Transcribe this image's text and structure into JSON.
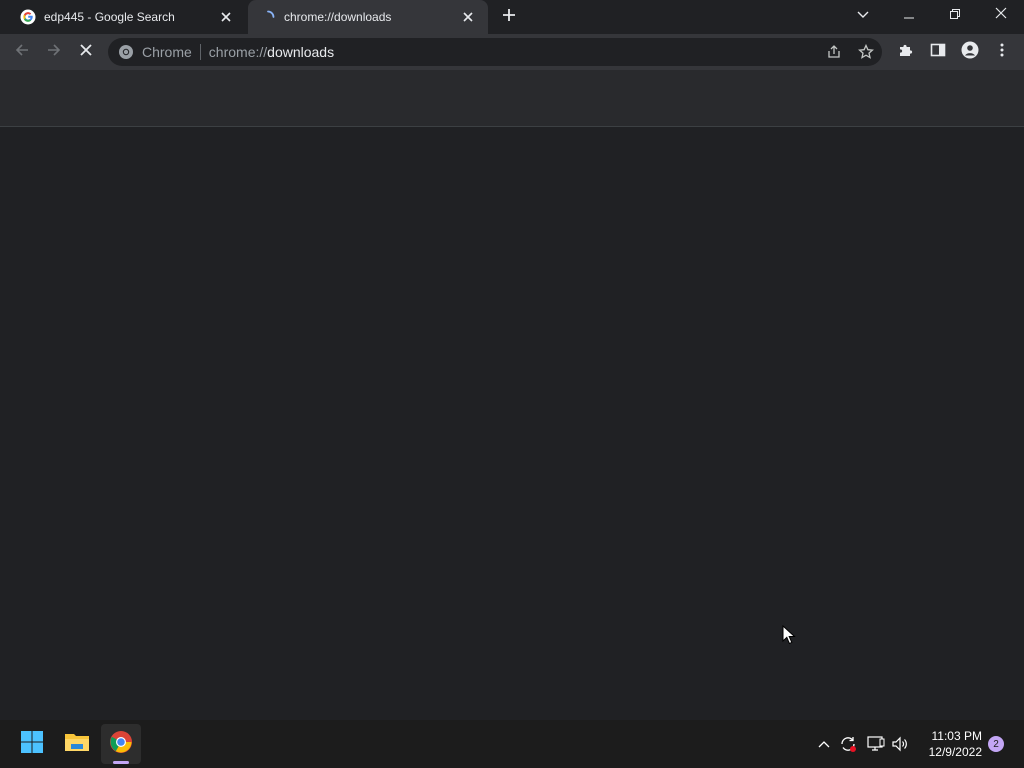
{
  "tabs": [
    {
      "title": "edp445 - Google Search",
      "active": false
    },
    {
      "title": "chrome://downloads",
      "active": true,
      "loading": true
    }
  ],
  "window_controls": [
    "tab-search-icon",
    "minimize-icon",
    "restore-icon",
    "close-icon"
  ],
  "omnibox": {
    "chip": "Chrome",
    "url_scheme": "chrome://",
    "url_host": "downloads"
  },
  "toolbar_icons": [
    "back-icon",
    "forward-icon",
    "stop-icon",
    "share-icon",
    "bookmark-star-icon",
    "extensions-icon",
    "side-panel-icon",
    "profile-icon",
    "menu-icon"
  ],
  "taskbar": {
    "apps": [
      "start",
      "file-explorer",
      "chrome"
    ],
    "time": "11:03 PM",
    "date": "12/9/2022",
    "notification_count": "2"
  },
  "colors": {
    "background": "#202124",
    "toolbar": "#35363a",
    "taskbar": "#1c1c1c",
    "notification_badge": "#c3a6f5"
  }
}
